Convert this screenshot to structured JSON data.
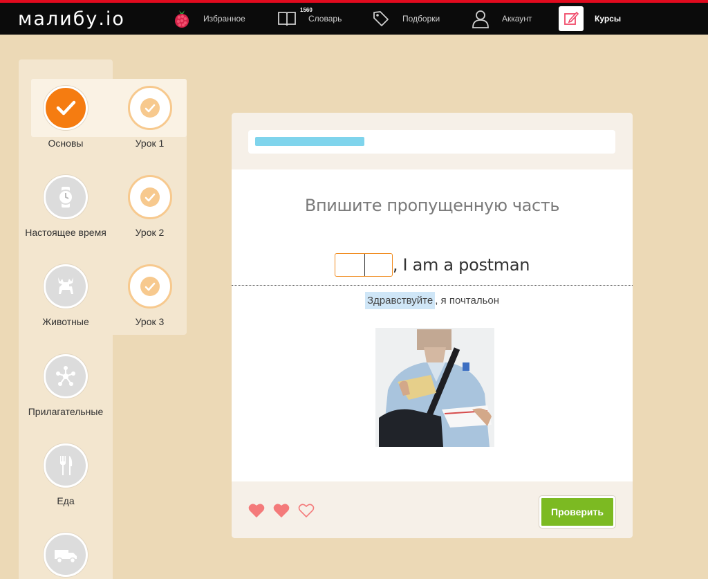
{
  "app": {
    "logo": "малибу.io"
  },
  "nav": {
    "favorites": "Избранное",
    "dictionary": "Словарь",
    "dictionary_count": "1560",
    "collections": "Подборки",
    "account": "Аккаунт",
    "courses": "Курсы"
  },
  "courses": [
    {
      "label": "Основы",
      "icon": "check-icon",
      "state": "done"
    },
    {
      "label": "Настоящее время",
      "icon": "watch-icon"
    },
    {
      "label": "Животные",
      "icon": "moose-icon"
    },
    {
      "label": "Прилагательные",
      "icon": "network-icon"
    },
    {
      "label": "Еда",
      "icon": "fork-knife-icon"
    },
    {
      "label": "",
      "icon": "truck-icon"
    }
  ],
  "lessons": [
    {
      "label": "Урок 1",
      "state": "done"
    },
    {
      "label": "Урок 2",
      "state": "done"
    },
    {
      "label": "Урок 3",
      "state": "done"
    }
  ],
  "exercise": {
    "progress": 0.31,
    "title": "Впишите пропущенную часть",
    "sentence_rest": ", I am a postman",
    "translation_highlight": "Здравствуйте",
    "translation_rest": ", я почтальон",
    "lives": {
      "total": 3,
      "filled": 2
    },
    "check_button": "Проверить"
  },
  "colors": {
    "accent": "#f57c11",
    "brand_red": "#e10a1e",
    "progress": "#7fd4ec",
    "button": "#7cba22",
    "heart": "#f47a7a"
  }
}
